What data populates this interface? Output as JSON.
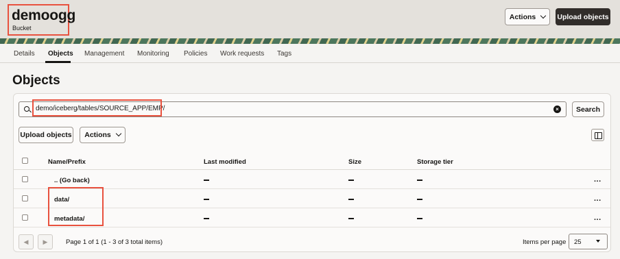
{
  "header": {
    "bucket_name": "demoogg",
    "bucket_type": "Bucket",
    "actions_label": "Actions",
    "upload_label": "Upload objects"
  },
  "tabs": [
    {
      "label": "Details"
    },
    {
      "label": "Objects",
      "active": true
    },
    {
      "label": "Management"
    },
    {
      "label": "Monitoring"
    },
    {
      "label": "Policies"
    },
    {
      "label": "Work requests"
    },
    {
      "label": "Tags"
    }
  ],
  "page": {
    "title": "Objects"
  },
  "search": {
    "value": "demo/iceberg/tables/SOURCE_APP/EMP/",
    "button_label": "Search",
    "clear_icon": "close-circle-icon",
    "search_icon": "search-icon"
  },
  "toolbar": {
    "upload_label": "Upload objects",
    "actions_label": "Actions",
    "column_toggle_icon": "split-panel-icon"
  },
  "table": {
    "columns": [
      "Name/Prefix",
      "Last modified",
      "Size",
      "Storage tier"
    ],
    "rows": [
      {
        "name": ".. (Go back)",
        "last_modified": "—",
        "size": "—",
        "storage_tier": "—"
      },
      {
        "name": "data/",
        "last_modified": "—",
        "size": "—",
        "storage_tier": "—"
      },
      {
        "name": "metadata/",
        "last_modified": "—",
        "size": "—",
        "storage_tier": "—"
      }
    ],
    "row_menu_label": "..."
  },
  "footer": {
    "prev_icon": "chevron-left-icon",
    "next_icon": "chevron-right-icon",
    "page_info": "Page 1 of 1 (1 - 3 of 3 total items)",
    "items_per_page_label": "Items per page",
    "items_per_page_value": "25"
  },
  "colors": {
    "highlight": "#e8513e",
    "primary_button": "#312d2a",
    "header_bg": "#e4e1dc"
  }
}
